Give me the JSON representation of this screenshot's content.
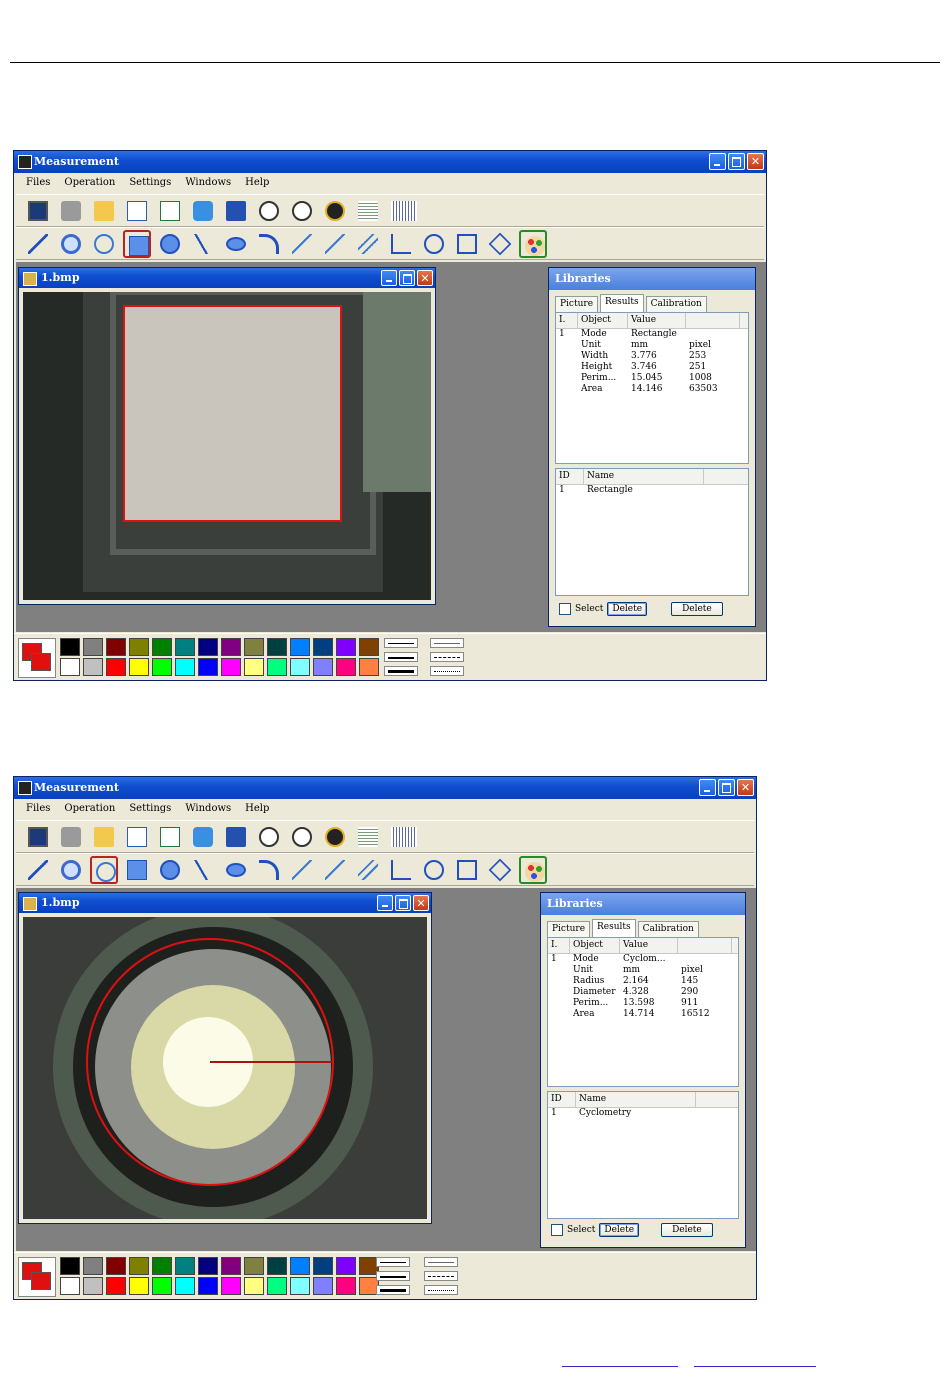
{
  "screens": [
    {
      "app_title": "Measurement",
      "menu": [
        "Files",
        "Operation",
        "Settings",
        "Windows",
        "Help"
      ],
      "doc_title": "1.bmp",
      "panel": {
        "title": "Libraries",
        "tabs": [
          "Picture",
          "Results",
          "Calibration"
        ],
        "active_tab": "Results",
        "results_columns": [
          "I.",
          "Object",
          "Value",
          ""
        ],
        "results_rows": [
          [
            "1",
            "Mode",
            "Rectangle",
            ""
          ],
          [
            "",
            "Unit",
            "mm",
            "pixel"
          ],
          [
            "",
            "Width",
            "3.776",
            "253"
          ],
          [
            "",
            "Height",
            "3.746",
            "251"
          ],
          [
            "",
            "Perim...",
            "15.045",
            "1008"
          ],
          [
            "",
            "Area",
            "14.146",
            "63503"
          ]
        ],
        "objects_columns": [
          "ID",
          "Name"
        ],
        "objects_rows": [
          [
            "1",
            "Rectangle"
          ]
        ],
        "select_label": "Select",
        "delete_label_1": "Delete",
        "delete_label_2": "Delete"
      }
    },
    {
      "app_title": "Measurement",
      "menu": [
        "Files",
        "Operation",
        "Settings",
        "Windows",
        "Help"
      ],
      "doc_title": "1.bmp",
      "panel": {
        "title": "Libraries",
        "tabs": [
          "Picture",
          "Results",
          "Calibration"
        ],
        "active_tab": "Results",
        "results_columns": [
          "I.",
          "Object",
          "Value",
          ""
        ],
        "results_rows": [
          [
            "1",
            "Mode",
            "Cyclom...",
            ""
          ],
          [
            "",
            "Unit",
            "mm",
            "pixel"
          ],
          [
            "",
            "Radius",
            "2.164",
            "145"
          ],
          [
            "",
            "Diameter",
            "4.328",
            "290"
          ],
          [
            "",
            "Perim...",
            "13.598",
            "911"
          ],
          [
            "",
            "Area",
            "14.714",
            "16512"
          ]
        ],
        "objects_columns": [
          "ID",
          "Name"
        ],
        "objects_rows": [
          [
            "1",
            "Cyclometry"
          ]
        ],
        "select_label": "Select",
        "delete_label_1": "Delete",
        "delete_label_2": "Delete"
      }
    }
  ],
  "toolbar1_icons": [
    "video-icon",
    "camera-icon",
    "open-folder-icon",
    "word-export-icon",
    "excel-export-icon",
    "refresh-icon",
    "save-icon",
    "pause-icon",
    "stop-icon",
    "settings-wrench-icon",
    "ruler-vertical-icon",
    "ruler-horizontal-icon"
  ],
  "toolbar2_icons": [
    "line-tool-icon",
    "magnifier-icon",
    "circle-3point-icon",
    "rectangle-tool-icon",
    "circle-tool-icon",
    "polyline-tool-icon",
    "ellipse-tool-icon",
    "arc-tool-icon",
    "dimension-tool-icon",
    "point-line-tool-icon",
    "parallel-tool-icon",
    "angle-tool-icon",
    "vertical-caliper-icon",
    "horizontal-caliper-icon",
    "diamond-tool-icon",
    "palette-icon"
  ],
  "selected_tool_screen1": "rectangle-tool-icon",
  "selected_tool_screen2": "circle-3point-icon",
  "palette_colors": [
    "#000000",
    "#808080",
    "#800000",
    "#808000",
    "#008000",
    "#008080",
    "#000080",
    "#800080",
    "#808040",
    "#004040",
    "#0080ff",
    "#004080",
    "#8000ff",
    "#804000",
    "#ffffff",
    "#c0c0c0",
    "#ff0000",
    "#ffff00",
    "#00ff00",
    "#00ffff",
    "#0000ff",
    "#ff00ff",
    "#ffff80",
    "#00ff80",
    "#80ffff",
    "#8080ff",
    "#ff0080",
    "#ff8040"
  ],
  "current_color": "#e01010",
  "measure_color": "#e01010"
}
